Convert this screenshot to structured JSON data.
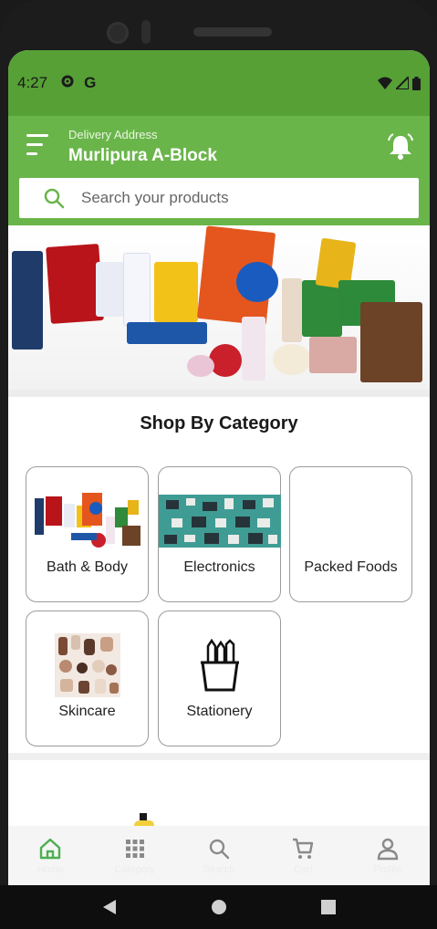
{
  "status_bar": {
    "time": "4:27",
    "icons": [
      "gear-icon",
      "g-icon",
      "wifi-icon",
      "signal-icon",
      "battery-icon"
    ],
    "g_letter": "G"
  },
  "header": {
    "address_label": "Delivery Address",
    "address_value": "Murlipura A-Block",
    "search_placeholder": "Search your products"
  },
  "category": {
    "title": "Shop By Category",
    "items": [
      {
        "label": "Bath & Body",
        "icon": "bath-body-image"
      },
      {
        "label": "Electronics",
        "icon": "electronics-image"
      },
      {
        "label": "Packed Foods",
        "icon": ""
      },
      {
        "label": "Skincare",
        "icon": "skincare-image"
      },
      {
        "label": "Stationery",
        "icon": "stationery-icon"
      }
    ]
  },
  "bottom_nav": [
    {
      "label": "Home",
      "icon": "home-icon",
      "active": true
    },
    {
      "label": "Category",
      "icon": "grid-icon",
      "active": false
    },
    {
      "label": "Search",
      "icon": "search-icon",
      "active": false
    },
    {
      "label": "Cart",
      "icon": "cart-icon",
      "active": false
    },
    {
      "label": "Profile",
      "icon": "profile-icon",
      "active": false
    }
  ],
  "colors": {
    "primary": "#6ab54a",
    "status_bar": "#56a035",
    "active_nav": "#4caf50",
    "inactive_nav": "#8a8a8a"
  }
}
